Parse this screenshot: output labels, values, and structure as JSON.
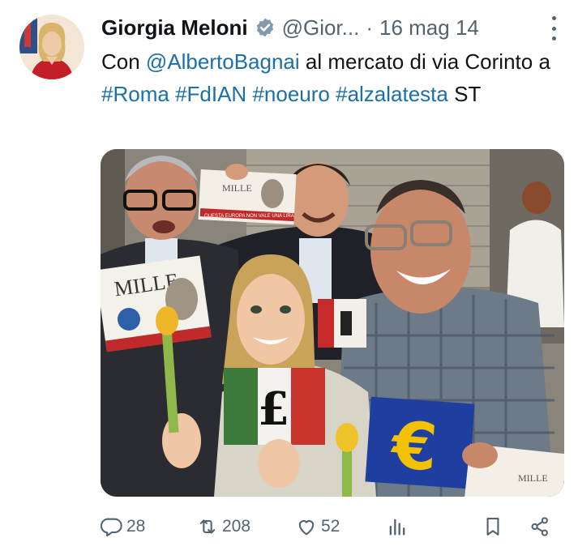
{
  "tweet": {
    "author_name": "Giorgia Meloni",
    "handle": "@Gior...",
    "separator": "·",
    "date": "16 mag 14",
    "text_parts": [
      {
        "text": "Con ",
        "link": false
      },
      {
        "text": "@AlbertoBagnai",
        "link": true
      },
      {
        "text": " al mercato di via Corinto a ",
        "link": false
      },
      {
        "text": "#Roma",
        "link": true
      },
      {
        "text": " ",
        "link": false
      },
      {
        "text": "#FdIAN",
        "link": true
      },
      {
        "text": " ",
        "link": false
      },
      {
        "text": "#noeuro",
        "link": true
      },
      {
        "text": " ",
        "link": false
      },
      {
        "text": "#alzalatesta",
        "link": true
      },
      {
        "text": " ST",
        "link": false
      }
    ]
  },
  "media": {
    "sign_text": "MILLE",
    "sign_slogan": "QUESTA EUROPA NON VALE UNA LIRA",
    "sign2_text": "MILLE",
    "flag_symbol": "£",
    "euro_symbol": "€",
    "paper_text": "MILLE"
  },
  "actions": {
    "replies": "28",
    "retweets": "208",
    "likes": "52"
  },
  "colors": {
    "link": "#1d6fa8",
    "secondary_text": "#536471",
    "verified_badge": "#829aab"
  },
  "icons": [
    "verified-badge-icon",
    "more-icon",
    "reply-icon",
    "retweet-icon",
    "like-icon",
    "views-icon",
    "bookmark-icon",
    "share-icon"
  ]
}
